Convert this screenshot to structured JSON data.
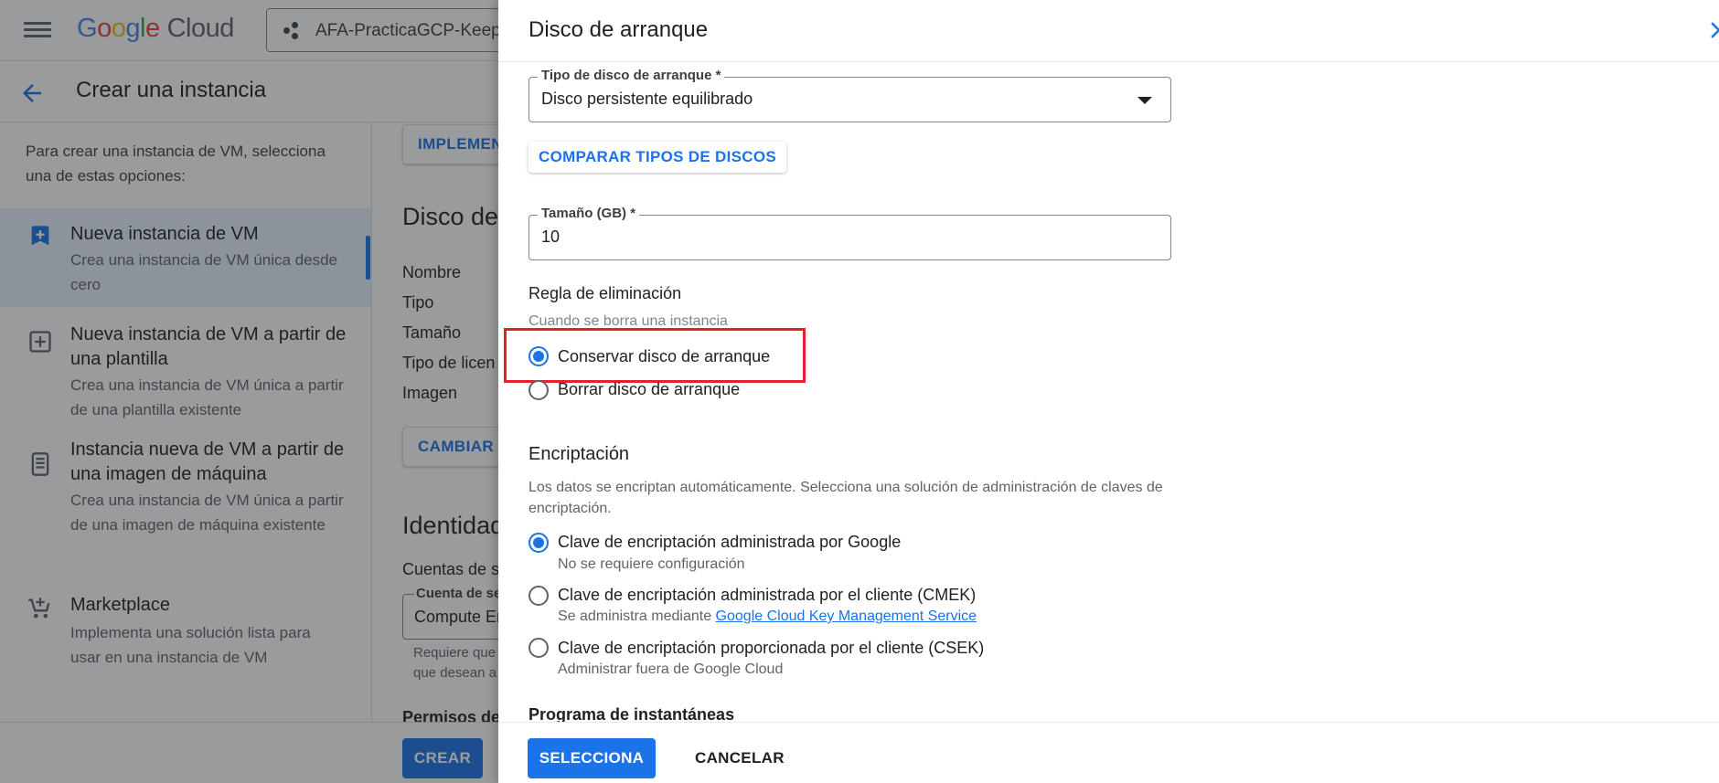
{
  "header": {
    "logo_google": "Google",
    "logo_cloud": "Cloud",
    "project_name": "AFA-PracticaGCP-KeepC"
  },
  "subheader": {
    "page_title": "Crear una instancia"
  },
  "leftnav": {
    "intro": "Para crear una instancia de VM, selecciona una de estas opciones:",
    "items": [
      {
        "title": "Nueva instancia de VM",
        "desc": "Crea una instancia de VM única desde cero",
        "icon": "add-box-icon",
        "active": true
      },
      {
        "title": "Nueva instancia de VM a partir de una plantilla",
        "desc": "Crea una instancia de VM única a partir de una plantilla existente",
        "icon": "template-add-icon",
        "active": false
      },
      {
        "title": "Instancia nueva de VM a partir de una imagen de máquina",
        "desc": "Crea una instancia de VM única a partir de una imagen de máquina existente",
        "icon": "machine-image-icon",
        "active": false
      },
      {
        "title": "Marketplace",
        "desc": "Implementa una solución lista para usar en una instancia de VM",
        "icon": "cart-add-icon",
        "active": false
      }
    ]
  },
  "middle": {
    "implement_btn": "IMPLEMEN",
    "disk_heading": "Disco de",
    "disk_fields": [
      "Nombre",
      "Tipo",
      "Tamaño",
      "Tipo de licen",
      "Imagen"
    ],
    "change_btn": "CAMBIAR",
    "identity_heading": "Identidad",
    "service_accounts_label": "Cuentas de se",
    "service_account_field_label": "Cuenta de se",
    "service_account_field_value": "Compute En",
    "hint_line1": "Requiere que",
    "hint_line2": "que desean a",
    "permissions_label": "Permisos de",
    "create_btn": "CREAR"
  },
  "panel": {
    "title": "Disco de arranque",
    "disk_type_label": "Tipo de disco de arranque *",
    "disk_type_value": "Disco persistente equilibrado",
    "compare_btn": "COMPARAR TIPOS DE DISCOS",
    "size_label": "Tamaño (GB) *",
    "size_value": "10",
    "deletion_rule": {
      "heading": "Regla de eliminación",
      "hint": "Cuando se borra una instancia",
      "options": [
        {
          "label": "Conservar disco de arranque",
          "checked": true
        },
        {
          "label": "Borrar disco de arranque",
          "checked": false
        }
      ]
    },
    "encryption": {
      "heading": "Encriptación",
      "desc": "Los datos se encriptan automáticamente. Selecciona una solución de administración de claves de encriptación.",
      "options": [
        {
          "label": "Clave de encriptación administrada por Google",
          "sub": "No se requiere configuración",
          "checked": true
        },
        {
          "label": "Clave de encriptación administrada por el cliente (CMEK)",
          "sub_prefix": "Se administra mediante",
          "sub_link": "Google Cloud Key Management Service",
          "checked": false
        },
        {
          "label": "Clave de encriptación proporcionada por el cliente (CSEK)",
          "sub": "Administrar fuera de Google Cloud",
          "checked": false
        }
      ]
    },
    "snapshot_heading": "Programa de instantáneas",
    "select_btn": "SELECCIONA",
    "cancel_btn": "CANCELAR"
  },
  "colors": {
    "accent": "#1a73e8",
    "highlight": "#e8202a"
  }
}
